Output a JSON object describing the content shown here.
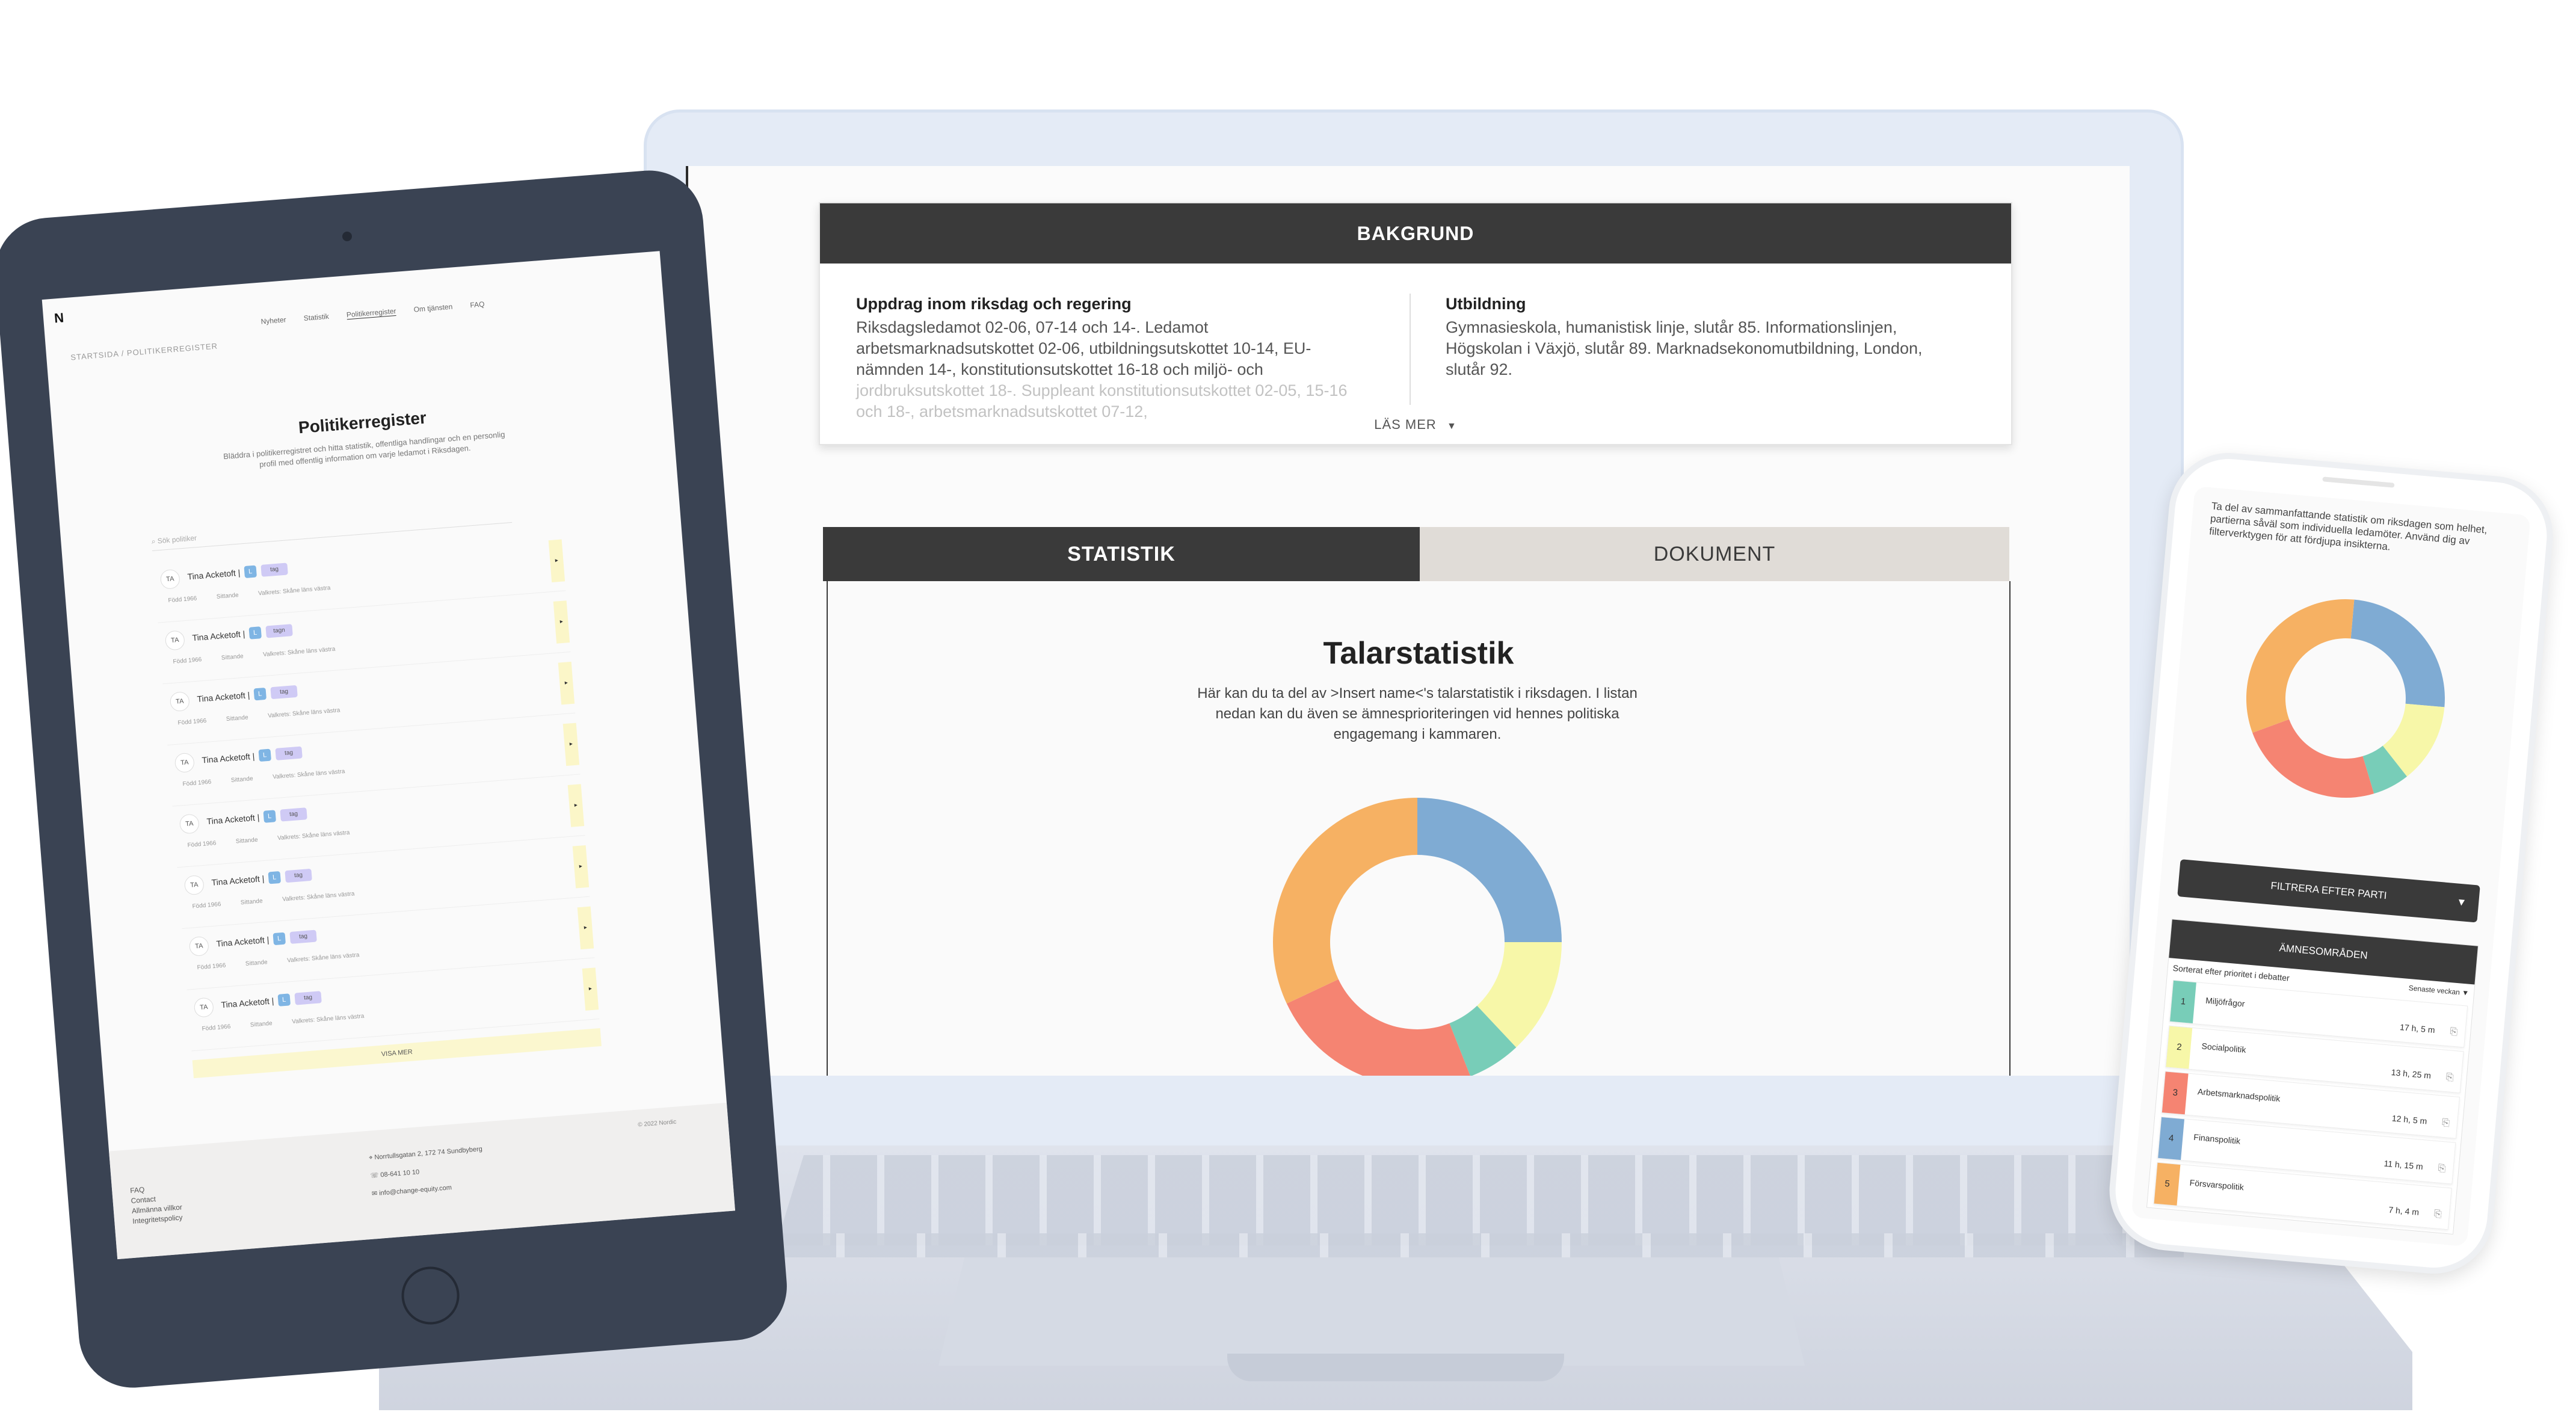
{
  "laptop": {
    "bakgrund": {
      "header": "BAKGRUND",
      "col1_title": "Uppdrag inom riksdag och regering",
      "col1_text": "Riksdagsledamot 02-06, 07-14 och 14-. Ledamot arbetsmarknadsutskottet 02-06, utbildningsutskottet 10-14, EU-nämnden 14-, konstitutionsutskottet 16-18 och miljö- och",
      "col1_fade": "jordbruksutskottet 18-. Suppleant konstitutionsutskottet 02-05, 15-16 och 18-, arbetsmarknadsutskottet 07-12,",
      "col2_title": "Utbildning",
      "col2_text": "Gymnasieskola, humanistisk linje, slutår 85. Informationslinjen, Högskolan i Växjö, slutår 89. Marknadsekonomutbildning, London, slutår 92.",
      "las_mer": "LÄS MER"
    },
    "tabs": [
      "STATISTIK",
      "DOKUMENT"
    ],
    "stats": {
      "title": "Talarstatistik",
      "desc": "Här kan du ta del av >Insert name<'s talarstatistik i riksdagen. I listan nedan kan du även se ämnesprioriteringen vid hennes politiska engagemang i kammaren."
    }
  },
  "donut_colors": [
    "#7fabd3",
    "#f7f7a8",
    "#78cdb8",
    "#f58472",
    "#f6b163"
  ],
  "donut_values": [
    25,
    13,
    6,
    24,
    32
  ],
  "tablet": {
    "logo": "N",
    "nav": [
      "Nyheter",
      "Statistik",
      "Politikerregister",
      "Om tjänsten",
      "FAQ"
    ],
    "crumb": "STARTSIDA  /  POLITIKERREGISTER",
    "title": "Politikerregister",
    "intro": "Bläddra i politikerregistret och hitta statistik, offentliga handlingar och en personlig profil med offentlig information om varje ledamot i Riksdagen.",
    "search_placeholder": "Sök politiker",
    "rows": [
      {
        "avatar": "TA",
        "name": "Tina Acketoft |",
        "party": "L",
        "tag": "tag",
        "meta": [
          "Född 1966",
          "Sittande",
          "Valkrets: Skåne läns västra"
        ]
      },
      {
        "avatar": "TA",
        "name": "Tina Acketoft |",
        "party": "L",
        "tag": "tagn",
        "meta": [
          "Född 1966",
          "Sittande",
          "Valkrets: Skåne läns västra"
        ]
      },
      {
        "avatar": "TA",
        "name": "Tina Acketoft |",
        "party": "L",
        "tag": "tag",
        "meta": [
          "Född 1966",
          "Sittande",
          "Valkrets: Skåne läns västra"
        ]
      },
      {
        "avatar": "TA",
        "name": "Tina Acketoft |",
        "party": "L",
        "tag": "tag",
        "meta": [
          "Född 1966",
          "Sittande",
          "Valkrets: Skåne läns västra"
        ]
      },
      {
        "avatar": "TA",
        "name": "Tina Acketoft |",
        "party": "L",
        "tag": "tag",
        "meta": [
          "Född 1966",
          "Sittande",
          "Valkrets: Skåne läns västra"
        ]
      },
      {
        "avatar": "TA",
        "name": "Tina Acketoft |",
        "party": "L",
        "tag": "tag",
        "meta": [
          "Född 1966",
          "Sittande",
          "Valkrets: Skåne läns västra"
        ]
      },
      {
        "avatar": "TA",
        "name": "Tina Acketoft |",
        "party": "L",
        "tag": "tag",
        "meta": [
          "Född 1966",
          "Sittande",
          "Valkrets: Skåne läns västra"
        ]
      },
      {
        "avatar": "TA",
        "name": "Tina Acketoft |",
        "party": "L",
        "tag": "tag",
        "meta": [
          "Född 1966",
          "Sittande",
          "Valkrets: Skåne läns västra"
        ]
      }
    ],
    "visa_mer": "VISA MER",
    "footer": {
      "links": [
        "FAQ",
        "Contact",
        "Allmänna villkor",
        "Integritetspolicy"
      ],
      "address": "Norrtullsgatan 2, 172 74 Sundbyberg",
      "phone": "08-641 10 10",
      "email": "info@change-equity.com",
      "copy": "© 2022 Nordic"
    }
  },
  "phone": {
    "intro": "Ta del av sammanfattande statistik om riksdagen som helhet, partierna såväl som individuella ledamöter. Använd dig av filterverktygen för att fördjupa insikterna.",
    "filter": "FILTRERA EFTER PARTI",
    "topics_header": "ÄMNESOMRÅDEN",
    "sort_label": "Sorterat efter prioritet i debatter",
    "sort_value": "Senaste veckan",
    "items": [
      {
        "num": "1",
        "label": "Miljöfrågor",
        "time": "17 h, 5 m",
        "color": "#78cdb8"
      },
      {
        "num": "2",
        "label": "Socialpolitik",
        "time": "13 h, 25 m",
        "color": "#f7f7a8"
      },
      {
        "num": "3",
        "label": "Arbetsmarknadspolitik",
        "time": "12 h, 5 m",
        "color": "#f58472"
      },
      {
        "num": "4",
        "label": "Finanspolitik",
        "time": "11 h, 15 m",
        "color": "#7fabd3"
      },
      {
        "num": "5",
        "label": "Försvarspolitik",
        "time": "7 h, 4 m",
        "color": "#f6b163"
      }
    ]
  }
}
